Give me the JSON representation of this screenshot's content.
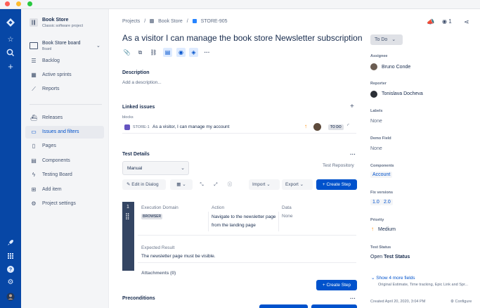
{
  "window": {
    "dot_colors": [
      "#ff5f57",
      "#febc2e",
      "#28c840"
    ]
  },
  "rail": {
    "icons": [
      "jira-logo-icon",
      "star-icon",
      "search-icon",
      "plus-icon",
      "rocket-icon",
      "apps-grid-icon",
      "help-icon",
      "settings-icon",
      "user-avatar"
    ]
  },
  "project": {
    "name": "Book Store",
    "type": "Classic software project",
    "board_title": "Book Store board",
    "board_sub": "Board"
  },
  "sidebar": {
    "group1": [
      {
        "label": "Backlog",
        "icon": "backlog-icon"
      },
      {
        "label": "Active sprints",
        "icon": "sprint-icon"
      },
      {
        "label": "Reports",
        "icon": "reports-icon"
      }
    ],
    "group2": [
      {
        "label": "Releases",
        "icon": "ship-icon"
      },
      {
        "label": "Issues and filters",
        "icon": "issues-icon",
        "selected": true
      },
      {
        "label": "Pages",
        "icon": "pages-icon"
      },
      {
        "label": "Components",
        "icon": "components-icon"
      },
      {
        "label": "Testing Board",
        "icon": "bolt-icon"
      },
      {
        "label": "Add item",
        "icon": "add-item-icon"
      },
      {
        "label": "Project settings",
        "icon": "gear-icon"
      }
    ]
  },
  "breadcrumb": {
    "items": [
      "Projects",
      "/",
      "Book Store",
      "/",
      "STORE-905"
    ]
  },
  "header": {
    "watchers_count": "1"
  },
  "issue": {
    "title": "As a visitor I can manage the book store Newsletter subscription",
    "description_label": "Description",
    "description_placeholder": "Add a description...",
    "linked_label": "Linked issues",
    "linked_relation": "blocks",
    "linked_key": "STORE-1",
    "linked_summary": "As a visitor, I can manage my account",
    "linked_status": "TO DO"
  },
  "test_details": {
    "label": "Test Details",
    "test_type": "Manual",
    "repository": "Test Repository",
    "edit_in_dialog": "Edit in Dialog",
    "import": "Import",
    "export": "Export",
    "create_step": "+ Create Step",
    "step": {
      "number": "1",
      "col_execution_domain": "Execution Domain",
      "col_action": "Action",
      "col_data": "Data",
      "domain_badge": "BROWSER",
      "action": "Navigate to the newsletter page from the landing page",
      "data": "None",
      "expected_label": "Expected Result",
      "expected": "The newsletter page must be visible.",
      "attachments": "Attachments (0)"
    },
    "create_step_bottom": "+ Create Step",
    "preconditions": "Preconditions"
  },
  "right_panel": {
    "status": "To Do",
    "assignee_label": "Assignee",
    "assignee": "Bruno Conde",
    "reporter_label": "Reporter",
    "reporter": "Tonislava Docheva",
    "labels_label": "Labels",
    "labels": "None",
    "demo_label": "Demo Field",
    "demo": "None",
    "components_label": "Components",
    "components": "Account",
    "fix_label": "Fix versions",
    "fix_versions": [
      "1.0",
      "2.0"
    ],
    "priority_label": "Priority",
    "priority": "Medium",
    "test_status_label": "Test Status",
    "test_status_prefix": "Open",
    "test_status_value": "Test Status",
    "more_fields": "Show 4 more fields",
    "more_fields_sub": "Original Estimate, Time tracking, Epic Link and Spr...",
    "created": "Created April 20, 2020, 3:04 PM",
    "configure": "Configure"
  },
  "colors": {
    "rail": "#0747a6",
    "primary": "#0052cc",
    "sidebar_bg": "#f4f5f7"
  }
}
